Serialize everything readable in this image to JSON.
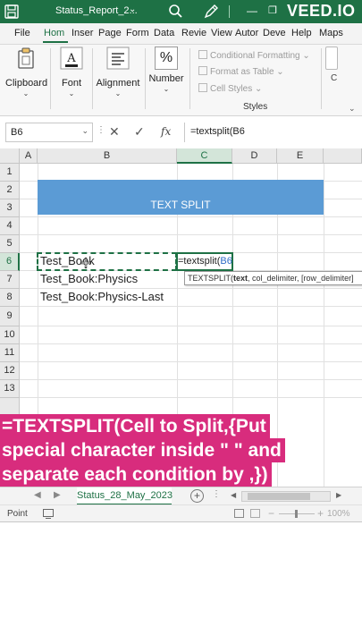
{
  "titlebar": {
    "doc_title": "Status_Report_2...",
    "dropdown_glyph": "⌄",
    "watermark": "VEED.IO",
    "minimize_glyph": "—",
    "restore_glyph": "❐",
    "color": "#1e7145"
  },
  "tabs": [
    "File",
    "Hom",
    "Inser",
    "Page",
    "Form",
    "Data",
    "Revie",
    "View",
    "Autor",
    "Deve",
    "Help",
    "Maps"
  ],
  "active_tab": "Hom",
  "ribbon": {
    "clipboard": "Clipboard",
    "font": "Font",
    "alignment": "Alignment",
    "number": "Number",
    "number_symbol": "%",
    "conditional_formatting": "Conditional Formatting",
    "format_as_table": "Format as Table",
    "cell_styles": "Cell Styles",
    "styles_group": "Styles",
    "right_partial": "C",
    "dropdown_glyph": "⌄"
  },
  "formula_bar": {
    "name_box": "B6",
    "formula": "=textsplit(B6",
    "fx": "fx",
    "cancel": "✕",
    "enter": "✓",
    "dots": "⋮"
  },
  "grid": {
    "columns": [
      "A",
      "B",
      "C",
      "D",
      "E"
    ],
    "rows": [
      "1",
      "2",
      "3",
      "4",
      "5",
      "6",
      "7",
      "8",
      "9",
      "10",
      "11",
      "12",
      "13"
    ],
    "selected_column": "C",
    "selected_row": "6",
    "banner_text": "TEXT SPLIT",
    "banner_color": "#5b9bd5",
    "cells": {
      "b6": "Test_Book",
      "b7": "Test_Book:Physics",
      "b8": "Test_Book:Physics-Last"
    },
    "edit_formula_prefix": "=textsplit(",
    "edit_formula_ref": "B6",
    "tooltip": {
      "fn": "TEXTSPLIT(",
      "arg_bold": "text",
      "rest": ", col_delimiter, [row_delimiter]"
    }
  },
  "caption": {
    "line1": "=TEXTSPLIT(Cell to Split,{Put",
    "line2": "special character inside \" \" and",
    "line3": "separate each condition by ,})",
    "color": "#d82c7d"
  },
  "sheetbar": {
    "nav_left": "◀",
    "nav_right": "▶",
    "sheet_name": "Status_28_May_2023",
    "add_sheet": "+",
    "dots": "⋮",
    "scroll_left": "◀",
    "scroll_right": "▶"
  },
  "statusbar": {
    "mode": "Point",
    "zoom_minus": "−",
    "zoom_plus": "+",
    "zoom": "100%"
  }
}
